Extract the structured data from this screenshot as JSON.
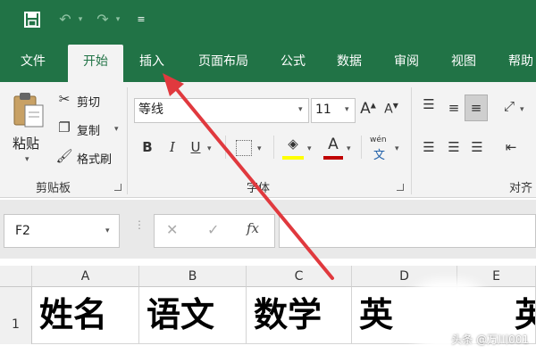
{
  "quick_access": {
    "save_icon": "save-icon",
    "undo_icon": "undo-icon",
    "redo_icon": "redo-icon",
    "customize_icon": "customize-qat-icon"
  },
  "tabs": [
    "文件",
    "开始",
    "插入",
    "页面布局",
    "公式",
    "数据",
    "审阅",
    "视图",
    "帮助"
  ],
  "active_tab": "开始",
  "ribbon": {
    "clipboard": {
      "paste_label": "粘贴",
      "cut_label": "剪切",
      "copy_label": "复制",
      "format_painter_label": "格式刷",
      "group_label": "剪贴板"
    },
    "font": {
      "font_name": "等线",
      "font_size": "11",
      "bold": "B",
      "italic": "I",
      "underline": "U",
      "font_color_letter": "A",
      "phonetic_label": "wén",
      "phonetic_sub": "文",
      "group_label": "字体",
      "fill_color": "#ffff00",
      "font_color": "#c00000"
    },
    "alignment": {
      "group_label": "对齐"
    }
  },
  "formula_bar": {
    "name_box": "F2",
    "cancel_symbol": "✕",
    "enter_symbol": "✓",
    "fx_symbol": "fx",
    "content": ""
  },
  "sheet": {
    "columns": [
      "A",
      "B",
      "C",
      "D",
      "E"
    ],
    "row_number": "1",
    "row1": [
      "姓名",
      "语文",
      "数学",
      "英",
      "英"
    ]
  },
  "watermark": "头条 @万川001",
  "colors": {
    "excel_green": "#217346",
    "arrow_red": "#e0393e"
  }
}
